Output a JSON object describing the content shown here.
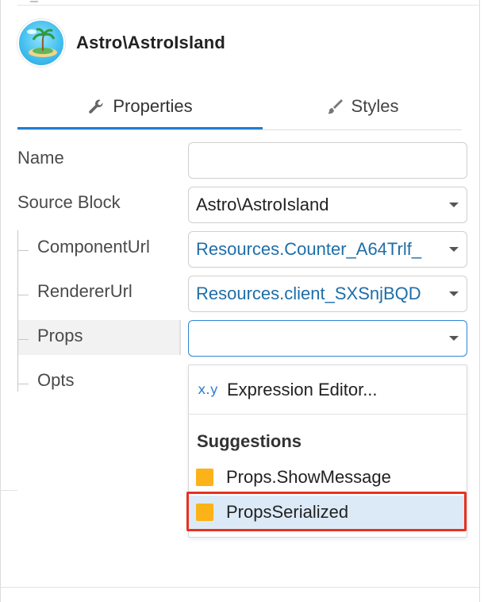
{
  "header": {
    "title": "Astro\\AstroIsland",
    "icon": "island-icon"
  },
  "tabs": [
    {
      "label": "Properties",
      "icon": "wrench-icon",
      "active": true
    },
    {
      "label": "Styles",
      "icon": "brush-icon",
      "active": false
    }
  ],
  "fields": {
    "name": {
      "label": "Name",
      "value": ""
    },
    "source_block": {
      "label": "Source Block",
      "value": "Astro\\AstroIsland"
    },
    "component_url": {
      "label": "ComponentUrl",
      "value": "Resources.Counter_A64Trlf_"
    },
    "renderer_url": {
      "label": "RendererUrl",
      "value": "Resources.client_SXSnjBQD"
    },
    "props": {
      "label": "Props",
      "value": ""
    },
    "opts": {
      "label": "Opts"
    }
  },
  "dropdown": {
    "expression_icon": "x.y",
    "expression_label": "Expression Editor...",
    "section_title": "Suggestions",
    "items": [
      {
        "label": "Props.ShowMessage",
        "color": "#fbb319"
      },
      {
        "label": "PropsSerialized",
        "color": "#fbb319",
        "highlighted": true
      }
    ]
  },
  "colors": {
    "accent": "#1f7ecf",
    "link_value": "#1e6ea8",
    "selection_outline": "#e8321f",
    "swatch": "#fbb319"
  }
}
